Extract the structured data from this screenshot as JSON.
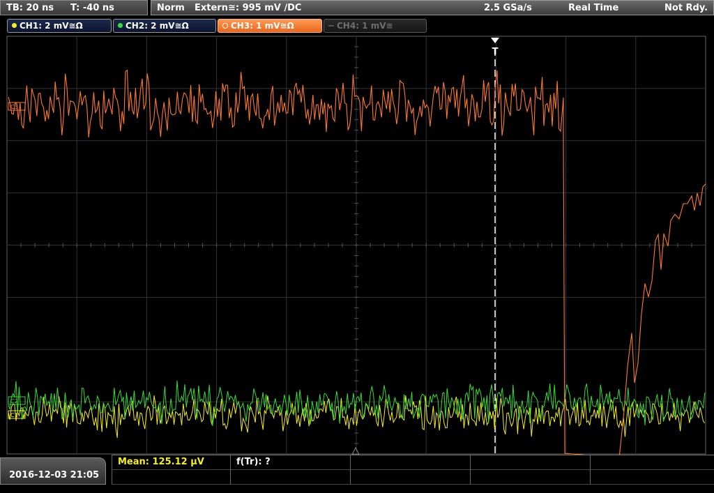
{
  "header": {
    "timebase": "TB: 20 ns",
    "trigger_time": "T: -40 ns",
    "mode": "Norm",
    "trigger_source": "Extern≅: 995 mV ∕DC",
    "sample_rate": "2.5 GSa/s",
    "acquisition": "Real Time",
    "status": "Not Rdy."
  },
  "channels": [
    {
      "label": "CH1: 2 mV≅Ω",
      "color": "#f5f01a",
      "active": true
    },
    {
      "label": "CH2: 2 mV≅Ω",
      "color": "#35e035",
      "active": true
    },
    {
      "label": "CH3: 1 mV≅Ω",
      "color": "#ff7a2a",
      "active": true,
      "selected": true
    },
    {
      "label": "CH4: 1 mV≅",
      "color": "#555555",
      "active": false
    }
  ],
  "markers": {
    "trigger": "T",
    "ch3": "C3",
    "ch2": "C2",
    "ch1": "C1"
  },
  "footer": {
    "datetime": "2016-12-03 21:05",
    "mean": "Mean: 125.12 µV",
    "freq": "f(Tr): ?"
  },
  "colors": {
    "ch1": "#f5f01a",
    "ch2": "#35e035",
    "ch3": "#ff7a2a",
    "grid": "#3a3a3a"
  }
}
